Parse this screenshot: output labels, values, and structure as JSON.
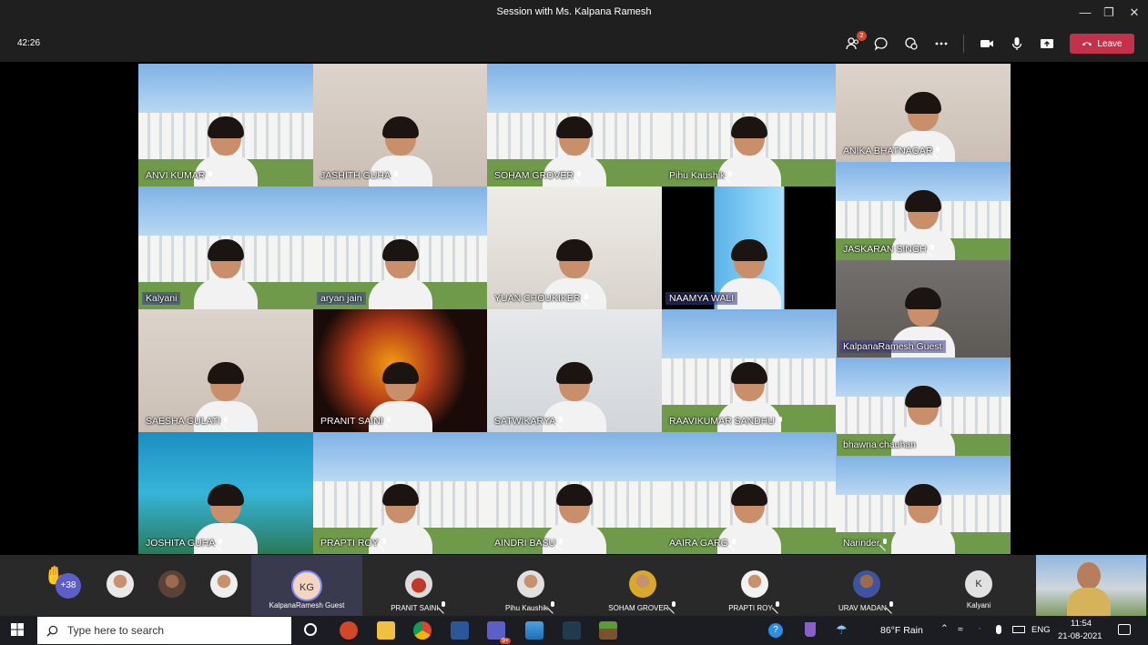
{
  "window": {
    "title": "Session with Ms. Kalpana Ramesh"
  },
  "toolbar": {
    "timer": "42:26",
    "participants_badge": "2",
    "leave_label": "Leave"
  },
  "tiles": [
    {
      "name": "ANVI  KUMAR",
      "mic": true,
      "bg": "building"
    },
    {
      "name": "JASHITH GUHA",
      "mic": true,
      "bg": "room"
    },
    {
      "name": "SOHAM  GROVER",
      "mic": true,
      "bg": "building"
    },
    {
      "name": "Pihu  Kaushik",
      "mic": true,
      "bg": "building"
    },
    {
      "name": "ANIKA  BHATNAGAR",
      "mic": true,
      "bg": "room"
    },
    {
      "name": "Kalyani",
      "mic": false,
      "bg": "building"
    },
    {
      "name": "aryan jain",
      "mic": false,
      "bg": "building"
    },
    {
      "name": "YUAN  CHOUKIKER",
      "mic": true,
      "bg": "chair"
    },
    {
      "name": "NAAMYA  WALI",
      "mic": false,
      "bg": "cartoon"
    },
    {
      "name": "JASKARAN  SINGH",
      "mic": true,
      "bg": "building"
    },
    {
      "name": "KalpanaRamesh Guest",
      "mic": false,
      "bg": "wall"
    },
    {
      "name": "SAESHA GULATI",
      "mic": true,
      "bg": "room"
    },
    {
      "name": "PRANIT  SAINI",
      "mic": true,
      "bg": "fire"
    },
    {
      "name": "SATWIKARYA",
      "mic": true,
      "bg": "taj"
    },
    {
      "name": "RAAVIKUMAR SANDHU",
      "mic": true,
      "bg": "building"
    },
    {
      "name": "bhawna chauhan",
      "mic": false,
      "bg": "building"
    },
    {
      "name": "JOSHITA  GUHA",
      "mic": true,
      "bg": "ocean"
    },
    {
      "name": "PRAPTI  ROY",
      "mic": true,
      "bg": "building"
    },
    {
      "name": "AINDRI  BASU",
      "mic": true,
      "bg": "building"
    },
    {
      "name": "AAIRA  GARG",
      "mic": true,
      "bg": "building"
    },
    {
      "name": "Narinder",
      "mic": true,
      "bg": "building"
    }
  ],
  "strip": {
    "overflow_count": "+38",
    "items": [
      {
        "label": "KalpanaRamesh Guest",
        "initials": "KG",
        "mic": false
      },
      {
        "label": "PRANIT SAINI",
        "mic": true
      },
      {
        "label": "Pihu Kaushik",
        "mic": true
      },
      {
        "label": "SOHAM GROVER",
        "mic": true
      },
      {
        "label": "PRAPTI ROY",
        "mic": true
      },
      {
        "label": "URAV MADAN",
        "mic": true
      },
      {
        "label": "Kalyani",
        "initials": "K",
        "mic": false
      }
    ]
  },
  "taskbar": {
    "search_placeholder": "Type here to search",
    "teams_badge": "9+",
    "weather": "86°F  Rain",
    "lang": "ENG",
    "time": "11:54",
    "date": "21-08-2021"
  },
  "colors": {
    "leave": "#c4314b",
    "chrome": "#1f1f1f",
    "strip": "#292929",
    "badge": "#cc4a31"
  }
}
